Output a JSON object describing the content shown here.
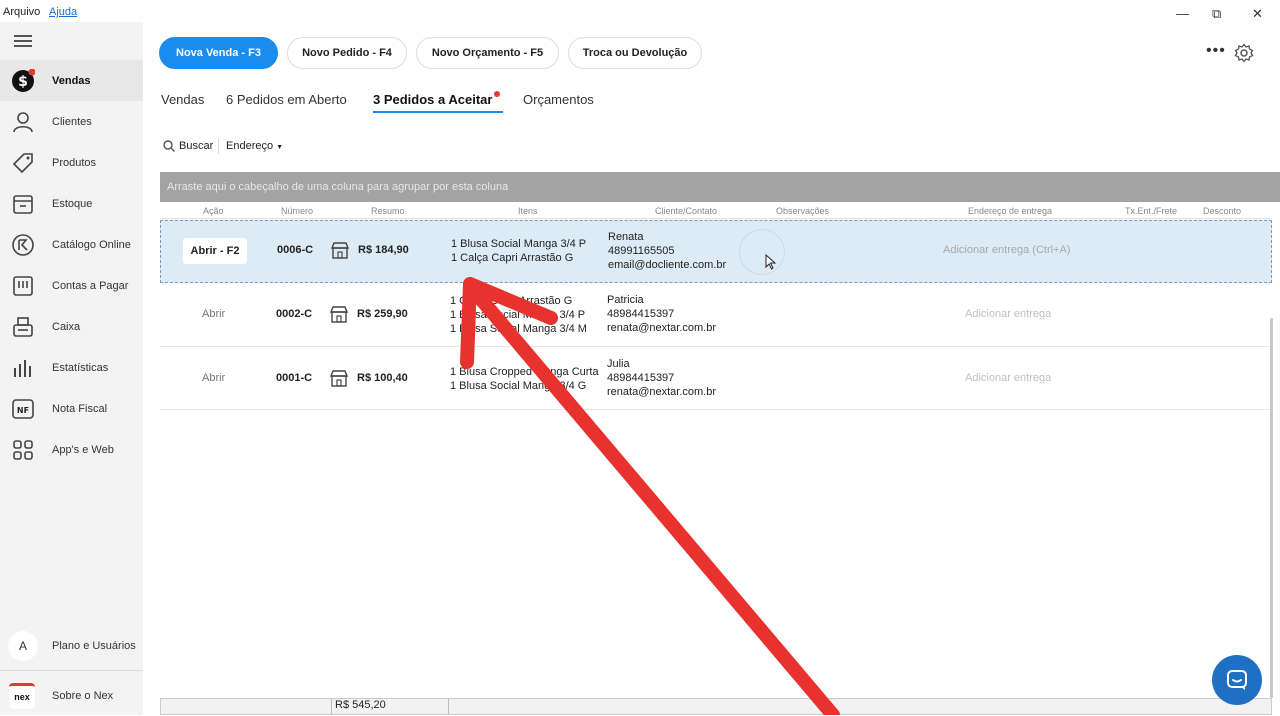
{
  "menu": {
    "file": "Arquivo",
    "help": "Ajuda"
  },
  "window": {
    "minimize": "—",
    "restore": "⧉",
    "close": "✕"
  },
  "sidebar": {
    "items": [
      {
        "label": "Vendas",
        "icon": "dollar-icon"
      },
      {
        "label": "Clientes",
        "icon": "person-icon"
      },
      {
        "label": "Produtos",
        "icon": "tag-icon"
      },
      {
        "label": "Estoque",
        "icon": "box-icon"
      },
      {
        "label": "Catálogo Online",
        "icon": "catalog-icon"
      },
      {
        "label": "Contas a Pagar",
        "icon": "bill-icon"
      },
      {
        "label": "Caixa",
        "icon": "register-icon"
      },
      {
        "label": "Estatísticas",
        "icon": "bars-icon"
      },
      {
        "label": "Nota Fiscal",
        "icon": "nf-icon",
        "badge": "NF"
      },
      {
        "label": "App's e Web",
        "icon": "grid-icon"
      }
    ],
    "plan": {
      "label": "Plano e Usuários",
      "avatar": "A"
    },
    "about": {
      "label": "Sobre o Nex",
      "logo": "nex"
    }
  },
  "actions": {
    "new_sale": "Nova Venda - F3",
    "new_order": "Novo Pedido - F4",
    "new_quote": "Novo Orçamento - F5",
    "exchange": "Troca ou Devolução"
  },
  "tabs": [
    {
      "label": "Vendas"
    },
    {
      "label": "6 Pedidos em Aberto"
    },
    {
      "label": "3 Pedidos a Aceitar"
    },
    {
      "label": "Orçamentos"
    }
  ],
  "toolbar": {
    "search": "Buscar",
    "address": "Endereço"
  },
  "group_hint": "Arraste aqui o cabeçalho de uma coluna para agrupar por esta coluna",
  "columns": [
    "Ação",
    "Número",
    "Resumo",
    "Itens",
    "Cliente/Contato",
    "Observações",
    "Endereço de entrega",
    "Tx.Ent./Frete",
    "Desconto"
  ],
  "rows": [
    {
      "action": "Abrir - F2",
      "number": "0006-C",
      "total": "R$ 184,90",
      "items": [
        "1  Blusa Social Manga 3/4 P",
        "1  Calça Capri Arrastão G"
      ],
      "client": [
        "Renata",
        "48991165505",
        "email@docliente.com.br"
      ],
      "delivery": "Adicionar entrega (Ctrl+A)"
    },
    {
      "action": "Abrir",
      "number": "0002-C",
      "total": "R$ 259,90",
      "items": [
        "1  Calça Capri Arrastão G",
        "1  Blusa Social Manga 3/4 P",
        "1  Blusa Social Manga 3/4 M"
      ],
      "client": [
        "Patricia",
        "48984415397",
        "renata@nextar.com.br"
      ],
      "delivery": "Adicionar entrega"
    },
    {
      "action": "Abrir",
      "number": "0001-C",
      "total": "R$ 100,40",
      "items": [
        "1  Blusa Cropped Manga Curta",
        "1  Blusa Social Manga 3/4 G"
      ],
      "client": [
        "Julia",
        "48984415397",
        "renata@nextar.com.br"
      ],
      "delivery": "Adicionar entrega"
    }
  ],
  "footer_total": "R$ 545,20",
  "colors": {
    "accent": "#1a8cf0",
    "arrow": "#e8322e",
    "selected_row": "#dcebf6"
  }
}
